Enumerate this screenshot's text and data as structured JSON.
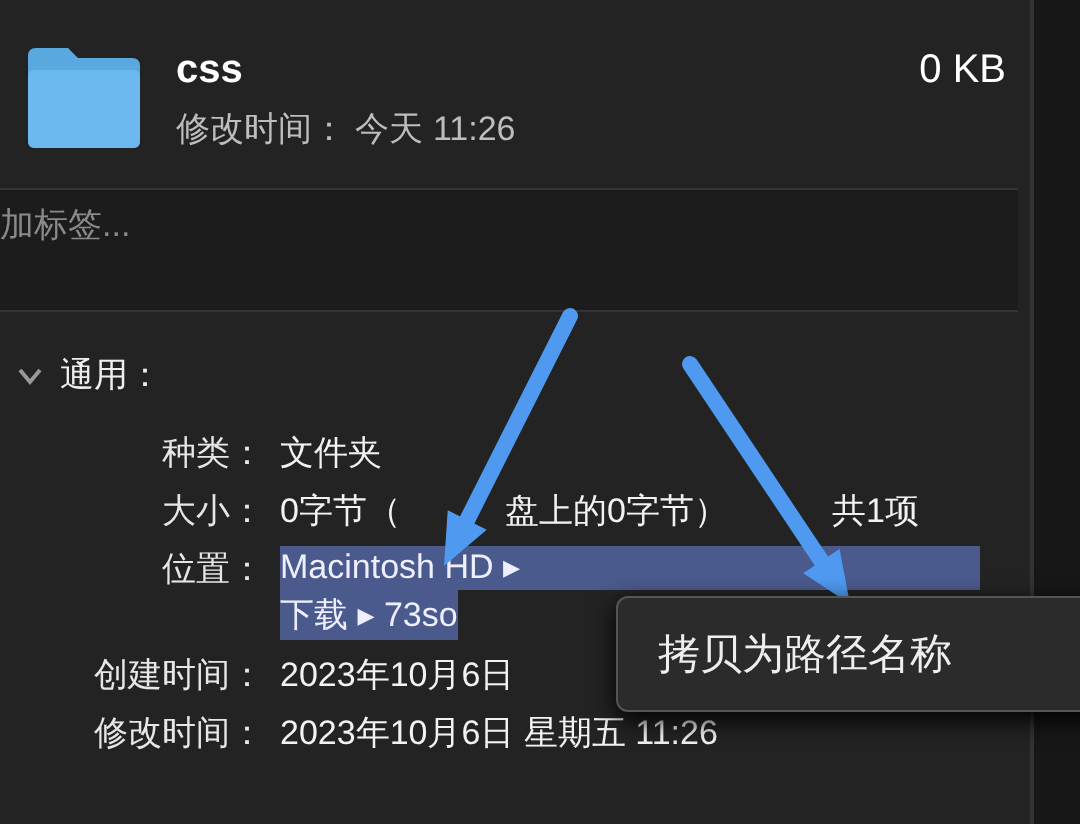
{
  "header": {
    "name": "css",
    "size": "0 KB",
    "modified": "修改时间： 今天 11:26"
  },
  "tags": {
    "placeholder": "加标签..."
  },
  "section": {
    "title": "通用：",
    "expanded": true
  },
  "rows": [
    {
      "label": "种类：",
      "kind": "text",
      "values": [
        "文件夹"
      ]
    },
    {
      "label": "大小：",
      "kind": "text",
      "values": [
        "0字节（",
        "盘上的0字节）",
        "共1项"
      ]
    },
    {
      "label": "位置：",
      "kind": "location",
      "values": [
        "Macintosh HD ▸",
        "下载 ▸ 73so"
      ]
    },
    {
      "label": "创建时间：",
      "kind": "text",
      "values": [
        "2023年10月6日"
      ]
    },
    {
      "label": "修改时间：",
      "kind": "text",
      "values": [
        "2023年10月6日 星期五 11:26"
      ]
    }
  ],
  "context_menu": {
    "items": [
      "拷贝为路径名称"
    ]
  }
}
